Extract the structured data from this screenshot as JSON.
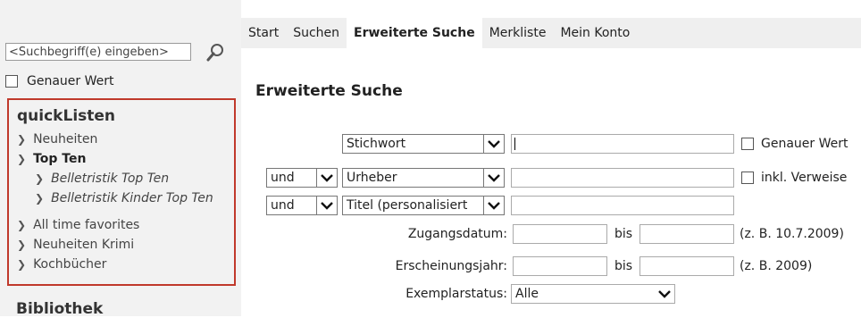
{
  "sidebar": {
    "search_placeholder": "<Suchbegriff(e) eingeben>",
    "exact_label": "Genauer Wert",
    "quicklist_title": "quickListen",
    "items": [
      {
        "label": "Neuheiten"
      },
      {
        "label": "Top Ten"
      },
      {
        "label": "Belletristik Top Ten"
      },
      {
        "label": "Belletristik Kinder Top Ten"
      },
      {
        "label": "All time favorites"
      },
      {
        "label": "Neuheiten Krimi"
      },
      {
        "label": "Kochbücher"
      }
    ],
    "section_bibliothek": "Bibliothek"
  },
  "tabs": [
    {
      "label": "Start"
    },
    {
      "label": "Suchen"
    },
    {
      "label": "Erweiterte Suche",
      "active": true
    },
    {
      "label": "Merkliste"
    },
    {
      "label": "Mein Konto"
    }
  ],
  "main": {
    "title": "Erweiterte Suche",
    "rows": [
      {
        "field": "Stichwort",
        "option_label": "Genauer Wert"
      },
      {
        "operator": "und",
        "field": "Urheber",
        "option_label": "inkl. Verweise"
      },
      {
        "operator": "und",
        "field": "Titel (personalisiert"
      }
    ],
    "date_label": "Zugangsdatum:",
    "year_label": "Erscheinungsjahr:",
    "bis": "bis",
    "date_hint": "(z. B. 10.7.2009)",
    "year_hint": "(z. B. 2009)",
    "status_label": "Exemplarstatus:",
    "status_value": "Alle"
  },
  "colors": {
    "highlight_border": "#c0392b",
    "tab_bar": "#efefef",
    "sidebar_bg": "#f2f2f2"
  }
}
